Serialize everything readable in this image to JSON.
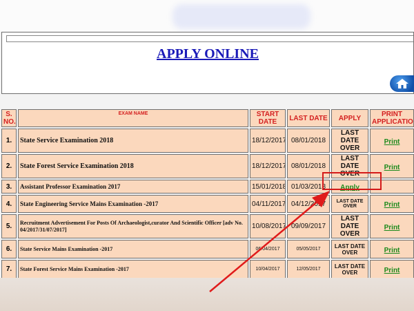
{
  "page": {
    "heading": "APPLY ONLINE"
  },
  "table": {
    "headers": {
      "sno": "S. NO.",
      "exam_name": "EXAM NAME",
      "start_date": "START DATE",
      "last_date": "LAST DATE",
      "apply": "APPLY",
      "print": "PRINT APPLICATION"
    },
    "rows": [
      {
        "no": "1.",
        "name": "State Service Examination 2018",
        "start": "18/12/2017",
        "last": "08/01/2018",
        "apply": "LAST DATE OVER",
        "print": "Print"
      },
      {
        "no": "2.",
        "name": "State Forest Service Examination 2018",
        "start": "18/12/2017",
        "last": "08/01/2018",
        "apply": "LAST DATE OVER",
        "print": "Print"
      },
      {
        "no": "3.",
        "name": "Assistant Professor Examination 2017",
        "start": "15/01/2018",
        "last": "01/03/2018",
        "apply": "Apply",
        "print": ""
      },
      {
        "no": "4.",
        "name": "State Engineering Service Mains Examination -2017",
        "start": "04/11/2017",
        "last": "04/12/2017",
        "apply": "LAST DATE OVER",
        "print": "Print"
      },
      {
        "no": "5.",
        "name": "Recruitment Advertisement For Posts Of Archaeologist,curator And Scientific Officer [adv No. 04/2017/31/07/2017]",
        "start": "10/08/2017",
        "last": "09/09/2017",
        "apply": "LAST DATE OVER",
        "print": "Print"
      },
      {
        "no": "6.",
        "name": "State Service Mains Examination -2017",
        "start": "06/04/2017",
        "last": "05/05/2017",
        "apply": "LAST DATE OVER",
        "print": "Print"
      },
      {
        "no": "7.",
        "name": "State Forest Service Mains Examination -2017",
        "start": "10/04/2017",
        "last": "12/05/2017",
        "apply": "LAST DATE OVER",
        "print": "Print"
      }
    ]
  },
  "colors": {
    "row_bg": "#fbd8bd",
    "header_text": "#d42020",
    "link": "#1c8a1c",
    "heading": "#1a1ab8",
    "annotation": "#d41a1a"
  }
}
